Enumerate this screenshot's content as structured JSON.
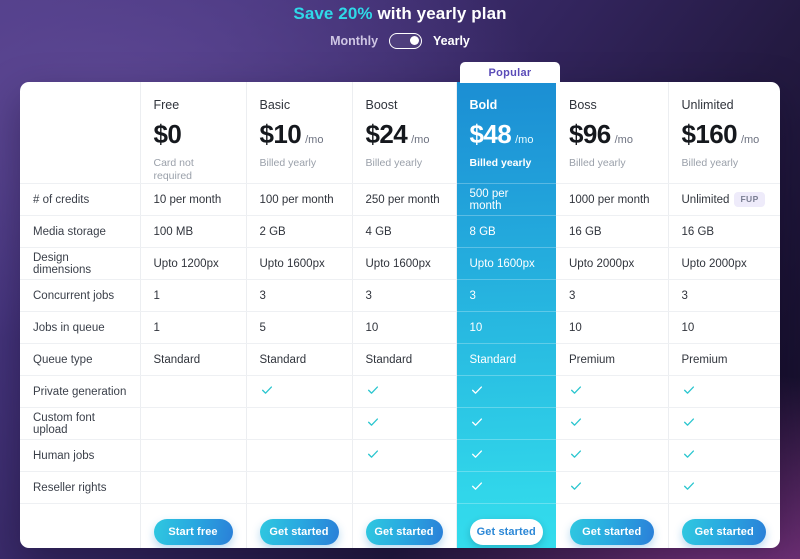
{
  "header": {
    "promo_prefix": "Save 20%",
    "promo_suffix": " with yearly plan",
    "accent_color": "#2fd9e8",
    "toggle": {
      "left_label": "Monthly",
      "right_label": "Yearly",
      "selected": "Yearly"
    }
  },
  "popular_badge": {
    "label": "Popular",
    "plan": "Bold"
  },
  "plans": [
    {
      "name": "Free",
      "price": "$0",
      "period": "",
      "note": "Card not required",
      "cta": "Start free",
      "highlighted": false
    },
    {
      "name": "Basic",
      "price": "$10",
      "period": "/mo",
      "note": "Billed yearly",
      "cta": "Get started",
      "highlighted": false
    },
    {
      "name": "Boost",
      "price": "$24",
      "period": "/mo",
      "note": "Billed yearly",
      "cta": "Get started",
      "highlighted": false
    },
    {
      "name": "Bold",
      "price": "$48",
      "period": "/mo",
      "note": "Billed yearly",
      "cta": "Get started",
      "highlighted": true
    },
    {
      "name": "Boss",
      "price": "$96",
      "period": "/mo",
      "note": "Billed yearly",
      "cta": "Get started",
      "highlighted": false
    },
    {
      "name": "Unlimited",
      "price": "$160",
      "period": "/mo",
      "note": "Billed yearly",
      "cta": "Get started",
      "highlighted": false
    }
  ],
  "features": [
    {
      "label": "# of credits",
      "type": "text",
      "values": [
        "10 per month",
        "100 per month",
        "250 per month",
        "500 per month",
        "1000 per month",
        "Unlimited"
      ],
      "badges": [
        "",
        "",
        "",
        "",
        "",
        "FUP"
      ]
    },
    {
      "label": "Media storage",
      "type": "text",
      "values": [
        "100 MB",
        "2 GB",
        "4 GB",
        "8 GB",
        "16 GB",
        "16 GB"
      ],
      "badges": [
        "",
        "",
        "",
        "",
        "",
        ""
      ]
    },
    {
      "label": "Design dimensions",
      "type": "text",
      "values": [
        "Upto 1200px",
        "Upto 1600px",
        "Upto 1600px",
        "Upto 1600px",
        "Upto 2000px",
        "Upto 2000px"
      ],
      "badges": [
        "",
        "",
        "",
        "",
        "",
        ""
      ]
    },
    {
      "label": "Concurrent jobs",
      "type": "text",
      "values": [
        "1",
        "3",
        "3",
        "3",
        "3",
        "3"
      ],
      "badges": [
        "",
        "",
        "",
        "",
        "",
        ""
      ]
    },
    {
      "label": "Jobs in queue",
      "type": "text",
      "values": [
        "1",
        "5",
        "10",
        "10",
        "10",
        "10"
      ],
      "badges": [
        "",
        "",
        "",
        "",
        "",
        ""
      ]
    },
    {
      "label": "Queue type",
      "type": "text",
      "values": [
        "Standard",
        "Standard",
        "Standard",
        "Standard",
        "Premium",
        "Premium"
      ],
      "badges": [
        "",
        "",
        "",
        "",
        "",
        ""
      ]
    },
    {
      "label": "Private generation",
      "type": "check",
      "values": [
        false,
        true,
        true,
        true,
        true,
        true
      ],
      "badges": [
        "",
        "",
        "",
        "",
        "",
        ""
      ]
    },
    {
      "label": "Custom font upload",
      "type": "check",
      "values": [
        false,
        false,
        true,
        true,
        true,
        true
      ],
      "badges": [
        "",
        "",
        "",
        "",
        "",
        ""
      ]
    },
    {
      "label": "Human jobs",
      "type": "check",
      "values": [
        false,
        false,
        true,
        true,
        true,
        true
      ],
      "badges": [
        "",
        "",
        "",
        "",
        "",
        ""
      ]
    },
    {
      "label": "Reseller rights",
      "type": "check",
      "values": [
        false,
        false,
        false,
        true,
        true,
        true
      ],
      "badges": [
        "",
        "",
        "",
        "",
        "",
        ""
      ]
    }
  ],
  "colors": {
    "check": "#2bc6cf",
    "highlight_top": "#1b8ed3",
    "highlight_bottom": "#34dced",
    "cta_gradient_from": "#2fc8e0",
    "cta_gradient_to": "#2a7fd8",
    "fup_badge_bg": "#eeebfa",
    "popular_text": "#5a4bb8"
  }
}
